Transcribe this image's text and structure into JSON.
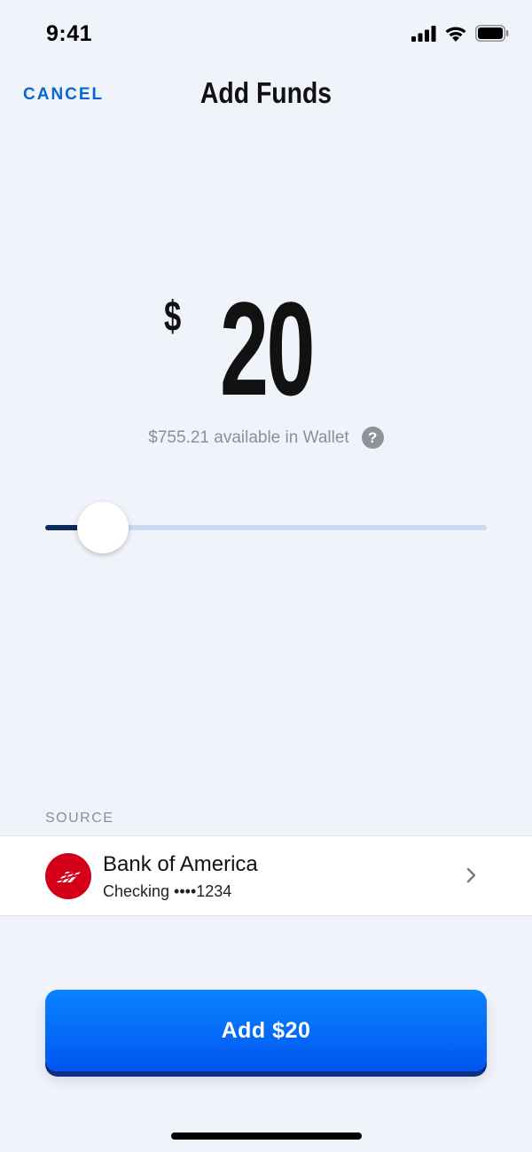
{
  "status_bar": {
    "time": "9:41"
  },
  "nav": {
    "cancel_label": "CANCEL",
    "title": "Add Funds"
  },
  "amount": {
    "currency": "$",
    "value": "20"
  },
  "balance": {
    "text": "$755.21 available in Wallet",
    "help_glyph": "?"
  },
  "slider": {
    "fraction": 0.13,
    "fill_color": "#0e2a5c",
    "track_color": "#c9dbf3"
  },
  "source": {
    "label": "SOURCE",
    "bank_name": "Bank of America",
    "account": "Checking ••••1234",
    "logo_color": "#d4001a"
  },
  "primary_button": {
    "label": "Add $20"
  },
  "icons": [
    "signal-icon",
    "wifi-icon",
    "battery-icon",
    "help-icon",
    "bank-logo-icon",
    "chevron-right-icon"
  ]
}
